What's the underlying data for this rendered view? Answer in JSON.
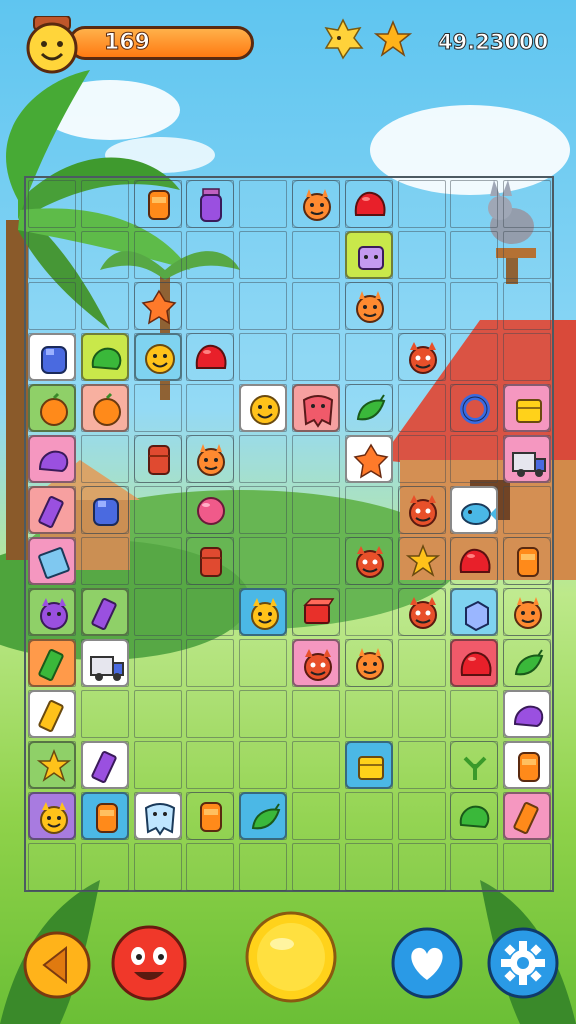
{
  "hud": {
    "score": "169",
    "coins": "49.23000",
    "icons": [
      "avatar-icon",
      "sun-icon",
      "star-icon"
    ]
  },
  "board": {
    "rows": 14,
    "cols": 10,
    "tiles": [
      {
        "r": 0,
        "c": 2,
        "icon": "orange-jar",
        "bg": "#ffffff00"
      },
      {
        "r": 0,
        "c": 3,
        "icon": "purple-jar",
        "bg": "#ffffff00"
      },
      {
        "r": 0,
        "c": 4,
        "icon": "empty",
        "bg": "plain"
      },
      {
        "r": 0,
        "c": 5,
        "icon": "orange-monster",
        "bg": "#ffffff00"
      },
      {
        "r": 0,
        "c": 6,
        "icon": "red-blob",
        "bg": "#ffffff00"
      },
      {
        "r": 1,
        "c": 6,
        "icon": "purple-robot",
        "bg": "#c9e84a"
      },
      {
        "r": 2,
        "c": 2,
        "icon": "orange-leaf",
        "bg": "#ffffff00"
      },
      {
        "r": 2,
        "c": 6,
        "icon": "orange-monster",
        "bg": "#ffffff00"
      },
      {
        "r": 3,
        "c": 0,
        "icon": "blue-jar",
        "bg": "#ffffff"
      },
      {
        "r": 3,
        "c": 1,
        "icon": "green-blob",
        "bg": "#c9e84a"
      },
      {
        "r": 3,
        "c": 2,
        "icon": "yellow-smile",
        "bg": "#7fd3f0"
      },
      {
        "r": 3,
        "c": 3,
        "icon": "red-blob",
        "bg": "#ffffff00"
      },
      {
        "r": 3,
        "c": 7,
        "icon": "red-monster",
        "bg": "#ffffff00"
      },
      {
        "r": 4,
        "c": 0,
        "icon": "orange-fruit",
        "bg": "#8fd068"
      },
      {
        "r": 4,
        "c": 1,
        "icon": "orange-fruit",
        "bg": "#f8b0a0"
      },
      {
        "r": 4,
        "c": 4,
        "icon": "yellow-smile",
        "bg": "#ffffff"
      },
      {
        "r": 4,
        "c": 5,
        "icon": "red-tooth",
        "bg": "#f7a0a0"
      },
      {
        "r": 4,
        "c": 6,
        "icon": "green-pepper",
        "bg": "#ffffff00"
      },
      {
        "r": 4,
        "c": 8,
        "icon": "blue-ring",
        "bg": "#ffffff00"
      },
      {
        "r": 4,
        "c": 9,
        "icon": "yellow-box",
        "bg": "#f597c0"
      },
      {
        "r": 5,
        "c": 0,
        "icon": "purple-blob",
        "bg": "#f597c0"
      },
      {
        "r": 5,
        "c": 2,
        "icon": "red-jar",
        "bg": "#ffffff00"
      },
      {
        "r": 5,
        "c": 3,
        "icon": "orange-monster",
        "bg": "#ffffff00"
      },
      {
        "r": 5,
        "c": 6,
        "icon": "orange-leaf",
        "bg": "#ffffff"
      },
      {
        "r": 5,
        "c": 9,
        "icon": "truck",
        "bg": "#f597c0"
      },
      {
        "r": 6,
        "c": 0,
        "icon": "purple-candy",
        "bg": "#f7a0a0"
      },
      {
        "r": 6,
        "c": 1,
        "icon": "blue-jar",
        "bg": "#ffffff00"
      },
      {
        "r": 6,
        "c": 3,
        "icon": "pink-blob",
        "bg": "#ffffff00"
      },
      {
        "r": 6,
        "c": 7,
        "icon": "red-monster",
        "bg": "#ffffff00"
      },
      {
        "r": 6,
        "c": 8,
        "icon": "blue-fish",
        "bg": "#ffffff"
      },
      {
        "r": 7,
        "c": 0,
        "icon": "book",
        "bg": "#f597c0"
      },
      {
        "r": 7,
        "c": 3,
        "icon": "red-jar",
        "bg": "#ffffff00"
      },
      {
        "r": 7,
        "c": 6,
        "icon": "red-monster",
        "bg": "#ffffff00"
      },
      {
        "r": 7,
        "c": 7,
        "icon": "yellow-star",
        "bg": "#ffffff00"
      },
      {
        "r": 7,
        "c": 8,
        "icon": "red-blob",
        "bg": "#ffffff00"
      },
      {
        "r": 7,
        "c": 9,
        "icon": "orange-jar",
        "bg": "#ffffff00"
      },
      {
        "r": 8,
        "c": 0,
        "icon": "purple-monster",
        "bg": "#8fd068"
      },
      {
        "r": 8,
        "c": 1,
        "icon": "purple-candy",
        "bg": "#8fd068"
      },
      {
        "r": 8,
        "c": 4,
        "icon": "yellow-monster",
        "bg": "#4bb8e6"
      },
      {
        "r": 8,
        "c": 5,
        "icon": "red-box",
        "bg": "#ffffff00"
      },
      {
        "r": 8,
        "c": 7,
        "icon": "red-monster",
        "bg": "#ffffff00"
      },
      {
        "r": 8,
        "c": 8,
        "icon": "blue-cube",
        "bg": "#7fd3f0"
      },
      {
        "r": 8,
        "c": 9,
        "icon": "orange-monster",
        "bg": "#ffffff00"
      },
      {
        "r": 9,
        "c": 0,
        "icon": "green-candy",
        "bg": "#ff9a4a"
      },
      {
        "r": 9,
        "c": 1,
        "icon": "truck",
        "bg": "#ffffff"
      },
      {
        "r": 9,
        "c": 5,
        "icon": "red-monster",
        "bg": "#f597c0"
      },
      {
        "r": 9,
        "c": 6,
        "icon": "orange-monster",
        "bg": "#ffffff00"
      },
      {
        "r": 9,
        "c": 8,
        "icon": "red-blob",
        "bg": "#f05a6a"
      },
      {
        "r": 9,
        "c": 9,
        "icon": "green-pepper",
        "bg": "#ffffff00"
      },
      {
        "r": 10,
        "c": 0,
        "icon": "yellow-candy",
        "bg": "#ffffff"
      },
      {
        "r": 10,
        "c": 9,
        "icon": "purple-blob",
        "bg": "#ffffff"
      },
      {
        "r": 11,
        "c": 0,
        "icon": "yellow-star",
        "bg": "#8fd068"
      },
      {
        "r": 11,
        "c": 1,
        "icon": "purple-candy",
        "bg": "#ffffff"
      },
      {
        "r": 11,
        "c": 6,
        "icon": "yellow-box",
        "bg": "#4bb8e6"
      },
      {
        "r": 11,
        "c": 8,
        "icon": "green-plant",
        "bg": "#ffffff00"
      },
      {
        "r": 11,
        "c": 9,
        "icon": "orange-jar",
        "bg": "#ffffff"
      },
      {
        "r": 12,
        "c": 0,
        "icon": "yellow-monster",
        "bg": "#a87be0"
      },
      {
        "r": 12,
        "c": 1,
        "icon": "orange-jar",
        "bg": "#4bb8e6"
      },
      {
        "r": 12,
        "c": 2,
        "icon": "blue-tooth",
        "bg": "#ffffff"
      },
      {
        "r": 12,
        "c": 3,
        "icon": "orange-jar",
        "bg": "#ffffff00"
      },
      {
        "r": 12,
        "c": 4,
        "icon": "green-pepper",
        "bg": "#4bb8e6"
      },
      {
        "r": 12,
        "c": 8,
        "icon": "green-blob",
        "bg": "#ffffff00"
      },
      {
        "r": 12,
        "c": 9,
        "icon": "orange-candy",
        "bg": "#f597c0"
      }
    ]
  },
  "controls": [
    "back-button",
    "face-button",
    "hint-button",
    "heart-button",
    "settings-button"
  ]
}
